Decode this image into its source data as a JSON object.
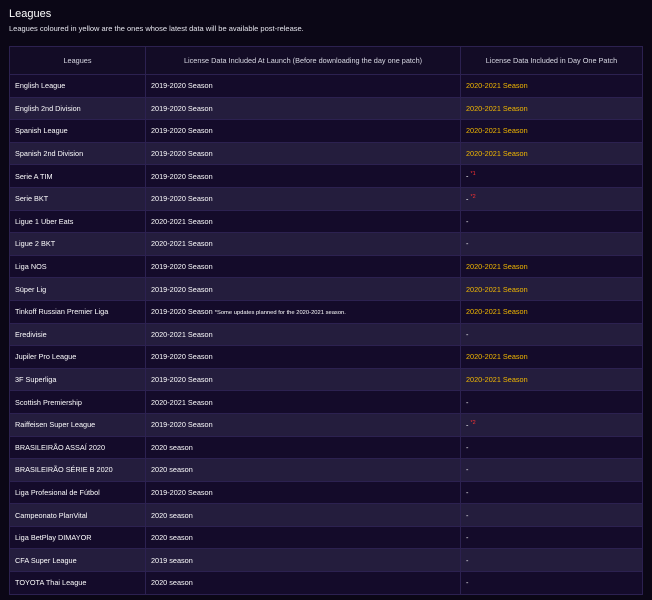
{
  "title": "Leagues",
  "subtitle": "Leagues coloured in yellow are the ones whose latest data will be available post-release.",
  "table": {
    "headers": [
      "Leagues",
      "License Data Included At Launch (Before downloading the day one patch)",
      "License Data Included in Day One Patch"
    ],
    "rows": [
      {
        "league": "English League",
        "launch": "2019-2020 Season",
        "note": "",
        "patch": "2020-2021 Season",
        "footnote": "",
        "highlight": true
      },
      {
        "league": "English 2nd Division",
        "launch": "2019-2020 Season",
        "note": "",
        "patch": "2020-2021 Season",
        "footnote": "",
        "highlight": true
      },
      {
        "league": "Spanish League",
        "launch": "2019-2020 Season",
        "note": "",
        "patch": "2020-2021 Season",
        "footnote": "",
        "highlight": true
      },
      {
        "league": "Spanish 2nd Division",
        "launch": "2019-2020 Season",
        "note": "",
        "patch": "2020-2021 Season",
        "footnote": "",
        "highlight": true
      },
      {
        "league": "Serie A TIM",
        "launch": "2019-2020 Season",
        "note": "",
        "patch": "-",
        "footnote": "*1",
        "highlight": false
      },
      {
        "league": "Serie BKT",
        "launch": "2019-2020 Season",
        "note": "",
        "patch": "-",
        "footnote": "*2",
        "highlight": false
      },
      {
        "league": "Ligue 1 Uber Eats",
        "launch": "2020-2021 Season",
        "note": "",
        "patch": "-",
        "footnote": "",
        "highlight": false
      },
      {
        "league": "Ligue 2 BKT",
        "launch": "2020-2021 Season",
        "note": "",
        "patch": "-",
        "footnote": "",
        "highlight": false
      },
      {
        "league": "Liga NOS",
        "launch": "2019-2020 Season",
        "note": "",
        "patch": "2020-2021 Season",
        "footnote": "",
        "highlight": true
      },
      {
        "league": "Süper Lig",
        "launch": "2019-2020 Season",
        "note": "",
        "patch": "2020-2021 Season",
        "footnote": "",
        "highlight": true
      },
      {
        "league": "Tinkoff Russian Premier Liga",
        "launch": "2019-2020 Season",
        "note": "*Some updates planned for the 2020-2021 season.",
        "patch": "2020-2021 Season",
        "footnote": "",
        "highlight": true
      },
      {
        "league": "Eredivisie",
        "launch": "2020-2021 Season",
        "note": "",
        "patch": "-",
        "footnote": "",
        "highlight": false
      },
      {
        "league": "Jupiler Pro League",
        "launch": "2019-2020 Season",
        "note": "",
        "patch": "2020-2021 Season",
        "footnote": "",
        "highlight": true
      },
      {
        "league": "3F Superliga",
        "launch": "2019-2020 Season",
        "note": "",
        "patch": "2020-2021 Season",
        "footnote": "",
        "highlight": true
      },
      {
        "league": "Scottish Premiership",
        "launch": "2020-2021 Season",
        "note": "",
        "patch": "-",
        "footnote": "",
        "highlight": false
      },
      {
        "league": "Raiffeisen Super League",
        "launch": "2019-2020 Season",
        "note": "",
        "patch": "-",
        "footnote": "*2",
        "highlight": false
      },
      {
        "league": "BRASILEIRÃO ASSAÍ 2020",
        "launch": "2020 season",
        "note": "",
        "patch": "-",
        "footnote": "",
        "highlight": false
      },
      {
        "league": "BRASILEIRÃO SÉRIE B 2020",
        "launch": "2020 season",
        "note": "",
        "patch": "-",
        "footnote": "",
        "highlight": false
      },
      {
        "league": "Liga Profesional de Fútbol",
        "launch": "2019-2020 Season",
        "note": "",
        "patch": "-",
        "footnote": "",
        "highlight": false
      },
      {
        "league": "Campeonato PlanVital",
        "launch": "2020 season",
        "note": "",
        "patch": "-",
        "footnote": "",
        "highlight": false
      },
      {
        "league": "Liga BetPlay DIMAYOR",
        "launch": "2020 season",
        "note": "",
        "patch": "-",
        "footnote": "",
        "highlight": false
      },
      {
        "league": "CFA Super League",
        "launch": "2019 season",
        "note": "",
        "patch": "-",
        "footnote": "",
        "highlight": false
      },
      {
        "league": "TOYOTA Thai League",
        "launch": "2020 season",
        "note": "",
        "patch": "-",
        "footnote": "",
        "highlight": false
      }
    ]
  },
  "colors": {
    "background": "#0b0716",
    "row_dark": "#140b2a",
    "row_light": "#241d3d",
    "highlight_yellow": "#f2b800",
    "footnote_red": "#ff3333",
    "border": "#2c2150"
  }
}
